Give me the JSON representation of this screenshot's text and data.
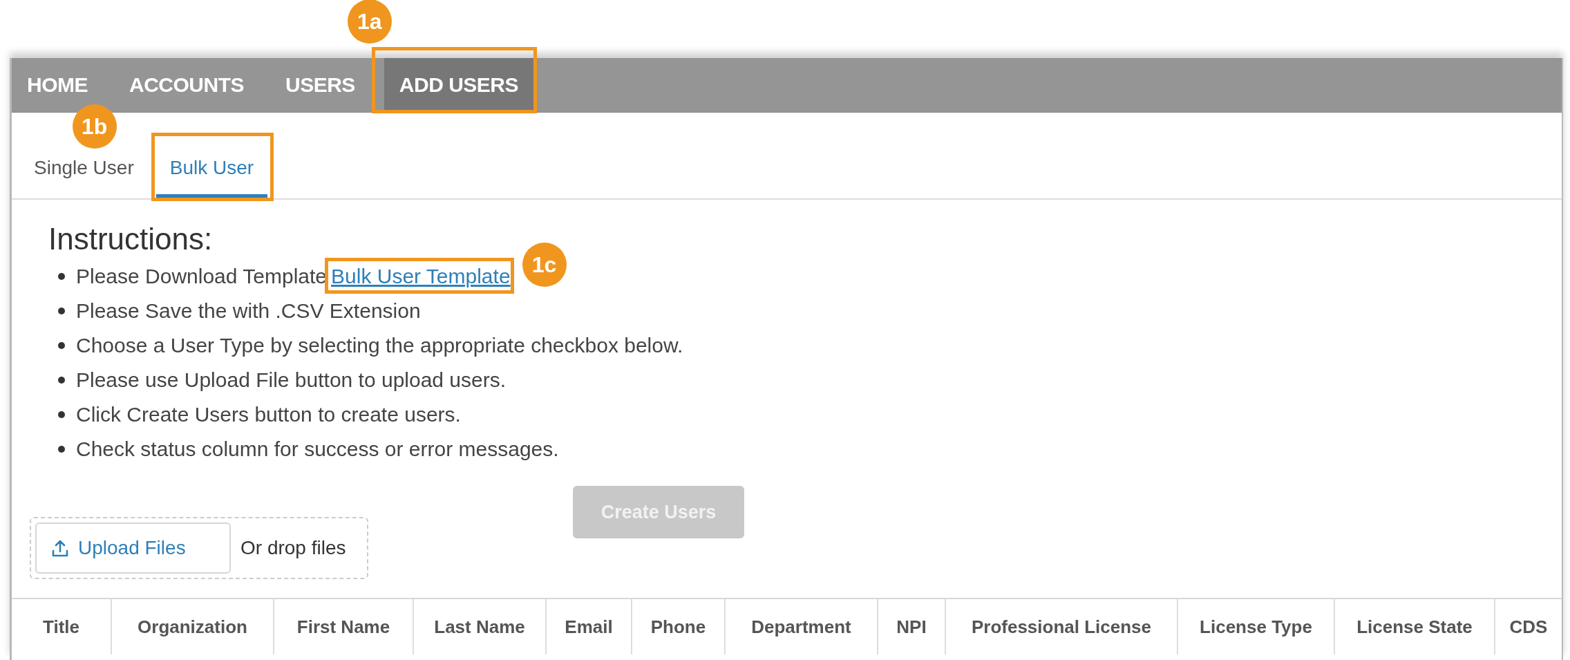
{
  "nav": {
    "items": [
      {
        "label": "HOME",
        "selected": false
      },
      {
        "label": "ACCOUNTS",
        "selected": false
      },
      {
        "label": "USERS",
        "selected": false
      },
      {
        "label": "ADD USERS",
        "selected": true,
        "callout": "1a"
      }
    ]
  },
  "tabs": [
    {
      "label": "Single User",
      "selected": false
    },
    {
      "label": "Bulk User",
      "selected": true,
      "callout": "1b"
    }
  ],
  "instructions": {
    "heading": "Instructions:",
    "items": [
      {
        "text": "Please Download Template",
        "link": "Bulk User Template",
        "callout": "1c"
      },
      {
        "text": "Please Save the with .CSV Extension"
      },
      {
        "text": "Choose a User Type by selecting the appropriate checkbox below."
      },
      {
        "text": "Please use Upload File button to upload users."
      },
      {
        "text": "Click Create Users button to create users."
      },
      {
        "text": "Check status column for success or error messages."
      }
    ]
  },
  "create_button": {
    "label": "Create Users",
    "disabled": true
  },
  "upload": {
    "button": "Upload Files",
    "drop_hint": "Or drop files"
  },
  "table": {
    "columns": [
      "Title",
      "Organization",
      "First Name",
      "Last Name",
      "Email",
      "Phone",
      "Department",
      "NPI",
      "Professional License",
      "License Type",
      "License State",
      "CDS"
    ]
  }
}
